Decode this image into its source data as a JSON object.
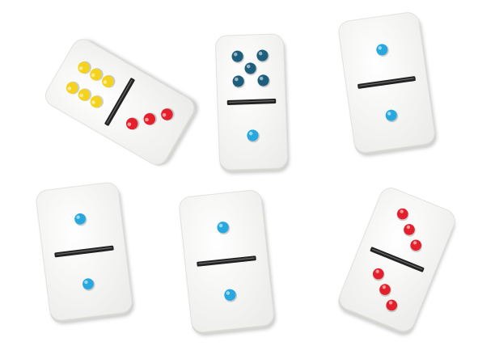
{
  "scene": {
    "subject": "dominoes",
    "background_color": "#ffffff"
  },
  "colors": {
    "tile_face": "#f7f7f5",
    "tile_shadow": "#d6d6d3",
    "divider": "#222222",
    "yellow": "#f5d21c",
    "red": "#e3202c",
    "blue": "#27a8de",
    "navy": "#1e5e7d"
  },
  "dominoes": [
    {
      "name": "domino-6-3",
      "top_pips": 6,
      "bottom_pips": 3,
      "top_color": "yellow",
      "bottom_color": "red"
    },
    {
      "name": "domino-5-1",
      "top_pips": 5,
      "bottom_pips": 1,
      "top_color": "navy",
      "bottom_color": "blue"
    },
    {
      "name": "domino-1-1-upper-right",
      "top_pips": 1,
      "bottom_pips": 1,
      "top_color": "blue",
      "bottom_color": "blue"
    },
    {
      "name": "domino-1-1-lower-left",
      "top_pips": 1,
      "bottom_pips": 1,
      "top_color": "blue",
      "bottom_color": "blue"
    },
    {
      "name": "domino-1-1-lower-middle",
      "top_pips": 1,
      "bottom_pips": 1,
      "top_color": "blue",
      "bottom_color": "blue"
    },
    {
      "name": "domino-3-3",
      "top_pips": 3,
      "bottom_pips": 3,
      "top_color": "red",
      "bottom_color": "red"
    }
  ]
}
